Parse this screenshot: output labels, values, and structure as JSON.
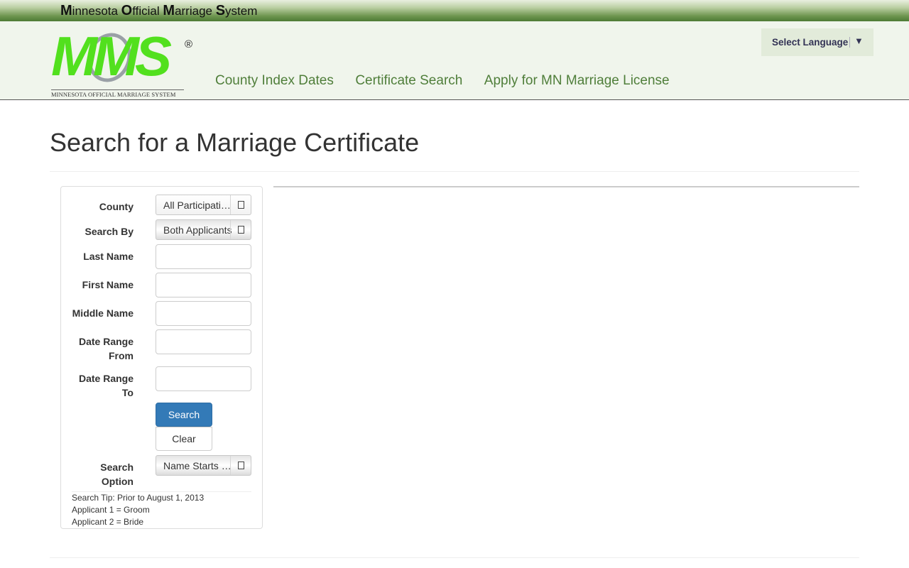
{
  "topbar": {
    "brand_m": "M",
    "brand_1": "innesota ",
    "brand_o": "O",
    "brand_2": "fficial ",
    "brand_m2": "M",
    "brand_3": "arriage ",
    "brand_s": "S",
    "brand_4": "ystem"
  },
  "logo": {
    "letters": "MMS",
    "reg": "®",
    "tagline": "MINNESOTA OFFICIAL MARRIAGE SYSTEM"
  },
  "nav": {
    "items": [
      {
        "label": "County Index Dates"
      },
      {
        "label": "Certificate Search"
      },
      {
        "label": "Apply for MN Marriage License"
      }
    ]
  },
  "language": {
    "label": "Select Language",
    "arrow": "▼"
  },
  "page": {
    "title": "Search for a Marriage Certificate"
  },
  "form": {
    "county": {
      "label": "County",
      "value": "All Participating Counties"
    },
    "search_by": {
      "label": "Search By",
      "value": "Both Applicants"
    },
    "last_name": {
      "label": "Last Name",
      "value": ""
    },
    "first_name": {
      "label": "First Name",
      "value": ""
    },
    "middle_name": {
      "label": "Middle Name",
      "value": ""
    },
    "date_from": {
      "label_1": "Date Range",
      "label_2": "From",
      "value": ""
    },
    "date_to": {
      "label_1": "Date Range",
      "label_2": "To",
      "value": ""
    },
    "search_button": "Search",
    "clear_button": "Clear",
    "search_option": {
      "label_1": "Search",
      "label_2": "Option",
      "value": "Name Starts With"
    },
    "tips": [
      "Search Tip: Prior to August 1, 2013",
      "Applicant 1 = Groom",
      "Applicant 2 = Bride"
    ]
  }
}
